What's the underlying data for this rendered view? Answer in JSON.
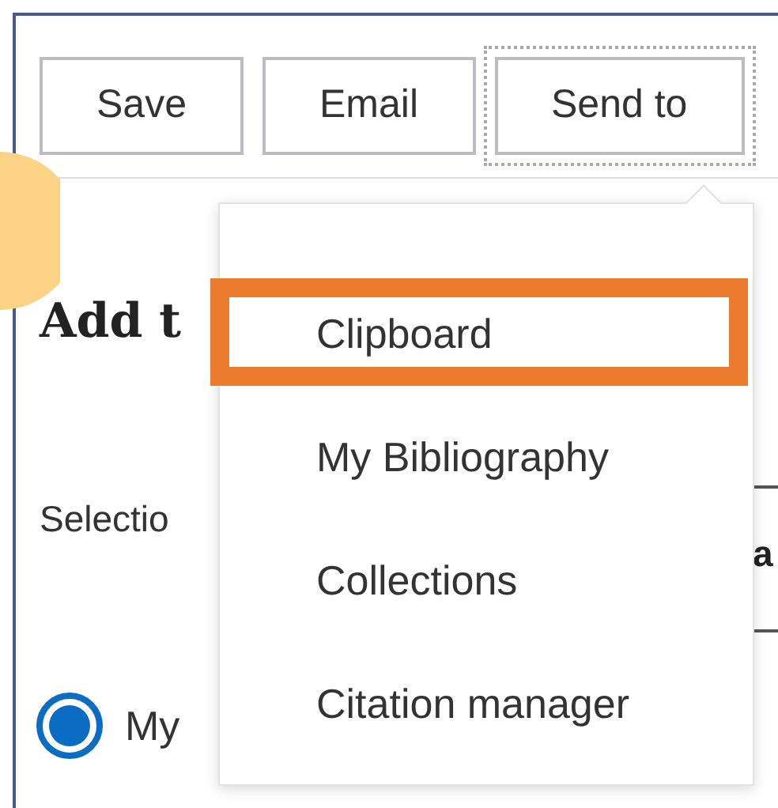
{
  "toolbar": {
    "buttons": [
      {
        "label": "Save",
        "focused": false
      },
      {
        "label": "Email",
        "focused": false
      },
      {
        "label": "Send to",
        "focused": true
      }
    ]
  },
  "panel": {
    "heading": "Add t",
    "selection_label": "Selectio",
    "column_text": "a",
    "radio": {
      "label": "My",
      "selected": true
    }
  },
  "menu": {
    "items": [
      {
        "label": "Clipboard",
        "highlighted": true
      },
      {
        "label": "My Bibliography",
        "highlighted": false
      },
      {
        "label": "Collections",
        "highlighted": false
      },
      {
        "label": "Citation manager",
        "highlighted": false
      }
    ]
  }
}
